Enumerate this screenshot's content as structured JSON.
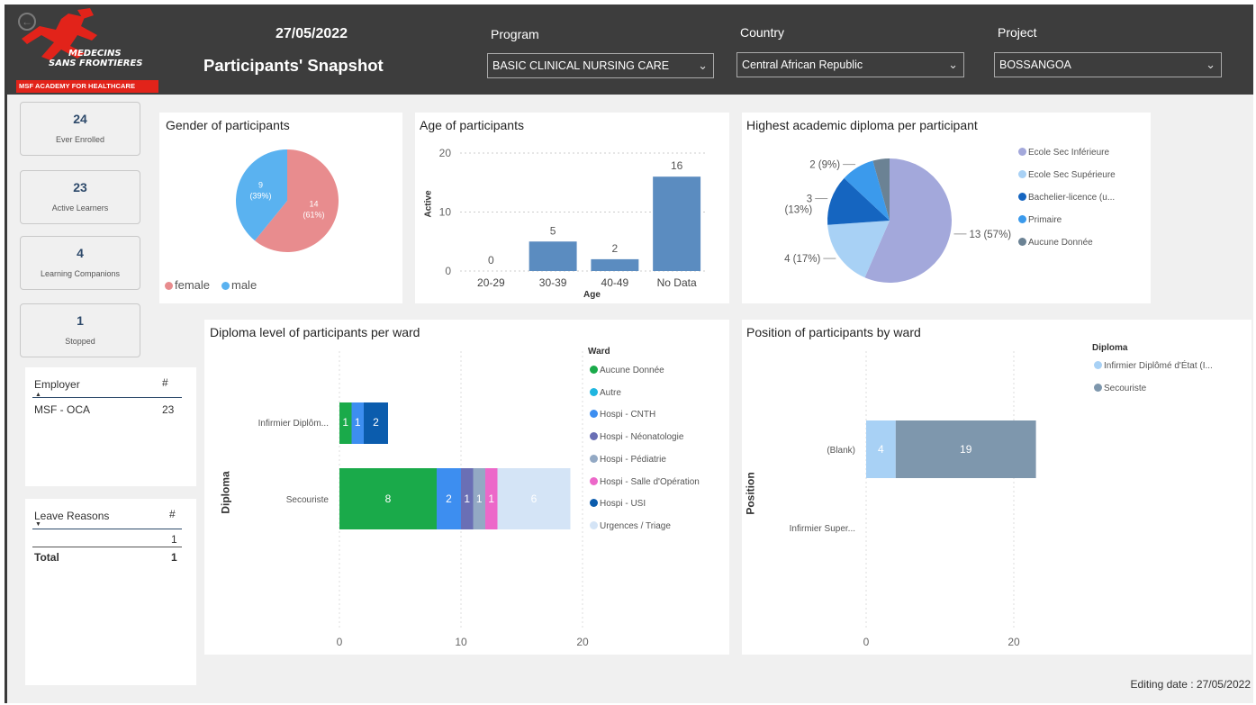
{
  "header": {
    "logo_text": "MEDECINS SANS FRONTIERES",
    "logo_line1": "MEDECINS",
    "logo_line2": "SANS FRONTIERES",
    "academy": "MSF ACADEMY FOR HEALTHCARE",
    "date": "27/05/2022",
    "title": "Participants' Snapshot"
  },
  "slicers": {
    "program": {
      "label": "Program",
      "value": "BASIC CLINICAL NURSING CARE"
    },
    "country": {
      "label": "Country",
      "value": "Central African Republic"
    },
    "project": {
      "label": "Project",
      "value": "BOSSANGOA"
    }
  },
  "cards": [
    {
      "value": "24",
      "label": "Ever Enrolled"
    },
    {
      "value": "23",
      "label": "Active Learners"
    },
    {
      "value": "4",
      "label": "Learning Companions"
    },
    {
      "value": "1",
      "label": "Stopped"
    }
  ],
  "employer_table": {
    "col1": "Employer",
    "col2": "#",
    "rows": [
      {
        "name": "MSF - OCA",
        "count": "23"
      }
    ]
  },
  "leave_table": {
    "col1": "Leave Reasons",
    "col2": "#",
    "rows": [
      {
        "name": "",
        "count": "1"
      }
    ],
    "total_label": "Total",
    "total_value": "1"
  },
  "gender_chart": {
    "title": "Gender of participants",
    "legend": [
      "female",
      "male"
    ]
  },
  "age_chart": {
    "title": "Age of participants",
    "ylabel": "Active",
    "xlabel": "Age"
  },
  "diploma_pie": {
    "title": "Highest academic diploma per participant"
  },
  "ward_chart": {
    "title": "Diploma level of participants per ward",
    "ylabel": "Diploma",
    "legend_title": "Ward"
  },
  "position_chart": {
    "title": "Position of participants by ward",
    "ylabel": "Position",
    "legend_title": "Diploma"
  },
  "footer": {
    "editing_date": "Editing date : 27/05/2022"
  },
  "colors": {
    "female": "#e88c8e",
    "male": "#5ab2f0",
    "bar": "#5b8cc0",
    "accent_red": "#e2231a"
  },
  "chart_data": [
    {
      "type": "pie",
      "title": "Gender of participants",
      "categories": [
        "female",
        "male"
      ],
      "values": [
        14,
        9
      ],
      "labels": [
        "14\n(61%)",
        "9\n(39%)"
      ],
      "colors": [
        "#e88c8e",
        "#5ab2f0"
      ]
    },
    {
      "type": "bar",
      "title": "Age of participants",
      "categories": [
        "20-29",
        "30-39",
        "40-49",
        "No Data"
      ],
      "values": [
        0,
        5,
        2,
        16
      ],
      "xlabel": "Age",
      "ylabel": "Active",
      "ylim": [
        0,
        20
      ],
      "yticks": [
        "0",
        "10",
        "20"
      ]
    },
    {
      "type": "pie",
      "title": "Highest academic diploma per participant",
      "categories": [
        "Ecole Sec Inférieure",
        "Ecole Sec Supérieure",
        "Bachelier-licence (u...",
        "Primaire",
        "Aucune Donnée"
      ],
      "values": [
        13,
        4,
        3,
        2,
        1
      ],
      "labels": [
        "13 (57%)",
        "4 (17%)",
        "3\n(13%)",
        "2 (9%)",
        ""
      ],
      "colors": [
        "#a3a8db",
        "#a8d1f5",
        "#1565c0",
        "#3b9aec",
        "#6b8294"
      ]
    },
    {
      "type": "bar",
      "orientation": "horizontal-stacked",
      "title": "Diploma level of participants per ward",
      "ylabel": "Diploma",
      "categories": [
        "Infirmier Diplôm...",
        "Secouriste"
      ],
      "series": [
        {
          "name": "Aucune Donnée",
          "color": "#1aaa4a",
          "values": [
            1,
            8
          ]
        },
        {
          "name": "Autre",
          "color": "#1fb6e0",
          "values": [
            0,
            0
          ]
        },
        {
          "name": "Hospi - CNTH",
          "color": "#3d8ef0",
          "values": [
            1,
            2
          ]
        },
        {
          "name": "Hospi - Néonatologie",
          "color": "#6a6fb5",
          "values": [
            0,
            1
          ]
        },
        {
          "name": "Hospi - Pédiatrie",
          "color": "#93a9c4",
          "values": [
            0,
            1
          ]
        },
        {
          "name": "Hospi - Salle d'Opération",
          "color": "#ec68c9",
          "values": [
            0,
            1
          ]
        },
        {
          "name": "Hospi - USI",
          "color": "#0b5cad",
          "values": [
            2,
            0
          ]
        },
        {
          "name": "Urgences / Triage",
          "color": "#d4e4f6",
          "values": [
            0,
            6
          ]
        }
      ],
      "xticks": [
        "0",
        "10",
        "20"
      ],
      "xlim": [
        0,
        20
      ]
    },
    {
      "type": "bar",
      "orientation": "horizontal-stacked",
      "title": "Position of participants by ward",
      "ylabel": "Position",
      "categories": [
        "(Blank)",
        "Infirmier Super..."
      ],
      "series": [
        {
          "name": "Infirmier Diplômé d'État (I...",
          "color": "#a8d1f5",
          "values": [
            4,
            0
          ]
        },
        {
          "name": "Secouriste",
          "color": "#7e97ad",
          "values": [
            19,
            0
          ]
        }
      ],
      "xticks": [
        "0",
        "20"
      ],
      "xlim": [
        0,
        20
      ]
    }
  ]
}
